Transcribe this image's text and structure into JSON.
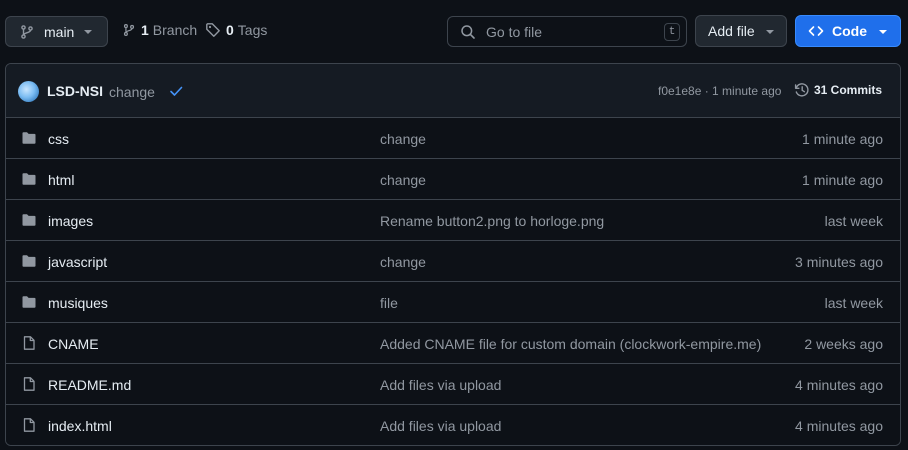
{
  "branch": {
    "name": "main"
  },
  "meta": {
    "branch_count": "1",
    "branch_label": "Branch",
    "tag_count": "0",
    "tag_label": "Tags"
  },
  "search": {
    "placeholder": "Go to file",
    "shortcut": "t"
  },
  "actions": {
    "add_file": "Add file",
    "code": "Code"
  },
  "colors": {
    "accent": "#1f6feb",
    "background": "#0d1117",
    "border": "#3d444d",
    "muted": "#9198a1"
  },
  "commit": {
    "author": "LSD-NSI",
    "message": "change",
    "sha_time": "f0e1e8e · 1 minute ago",
    "commit_count_label": "31 Commits"
  },
  "files": [
    {
      "icon": "folder-icon",
      "name": "css",
      "message": "change",
      "time": "1 minute ago"
    },
    {
      "icon": "folder-icon",
      "name": "html",
      "message": "change",
      "time": "1 minute ago"
    },
    {
      "icon": "folder-icon",
      "name": "images",
      "message": "Rename button2.png to horloge.png",
      "time": "last week"
    },
    {
      "icon": "folder-icon",
      "name": "javascript",
      "message": "change",
      "time": "3 minutes ago"
    },
    {
      "icon": "folder-icon",
      "name": "musiques",
      "message": "file",
      "time": "last week"
    },
    {
      "icon": "file-icon",
      "name": "CNAME",
      "message": "Added CNAME file for custom domain (clockwork-empire.me)",
      "time": "2 weeks ago"
    },
    {
      "icon": "file-icon",
      "name": "README.md",
      "message": "Add files via upload",
      "time": "4 minutes ago"
    },
    {
      "icon": "file-icon",
      "name": "index.html",
      "message": "Add files via upload",
      "time": "4 minutes ago"
    }
  ]
}
